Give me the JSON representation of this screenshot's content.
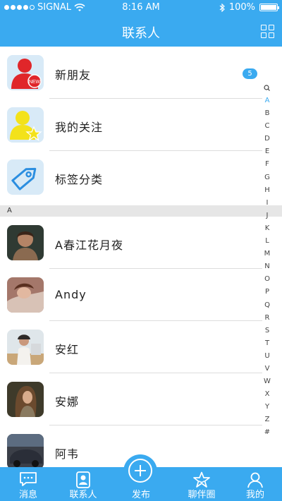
{
  "status": {
    "carrier": "SIGNAL",
    "time": "8:16 AM",
    "battery": "100%"
  },
  "nav": {
    "title": "联系人",
    "right_icon": "grid-icon"
  },
  "fixed_items": [
    {
      "label": "新朋友",
      "icon": "new-friend-icon",
      "badge": "5"
    },
    {
      "label": "我的关注",
      "icon": "follow-star-icon"
    },
    {
      "label": "标签分类",
      "icon": "tag-icon"
    }
  ],
  "section_header": "A",
  "contacts": [
    {
      "name": "A春江花月夜"
    },
    {
      "name": "Andy"
    },
    {
      "name": "安红"
    },
    {
      "name": "安娜"
    },
    {
      "name": "阿韦"
    }
  ],
  "index_letters": [
    "A",
    "B",
    "C",
    "D",
    "E",
    "F",
    "G",
    "H",
    "I",
    "J",
    "K",
    "L",
    "M",
    "N",
    "O",
    "P",
    "Q",
    "R",
    "S",
    "T",
    "U",
    "V",
    "W",
    "X",
    "Y",
    "Z",
    "#"
  ],
  "tabs": [
    {
      "label": "消息",
      "icon": "message-icon"
    },
    {
      "label": "联系人",
      "icon": "contacts-icon"
    },
    {
      "label": "发布",
      "icon": "publish-plus-icon"
    },
    {
      "label": "聊伴圈",
      "icon": "star-circle-icon"
    },
    {
      "label": "我的",
      "icon": "profile-icon"
    }
  ],
  "colors": {
    "primary": "#3aaaf0",
    "badge": "#3aaaf0",
    "section_bg": "#e6e6e6"
  }
}
